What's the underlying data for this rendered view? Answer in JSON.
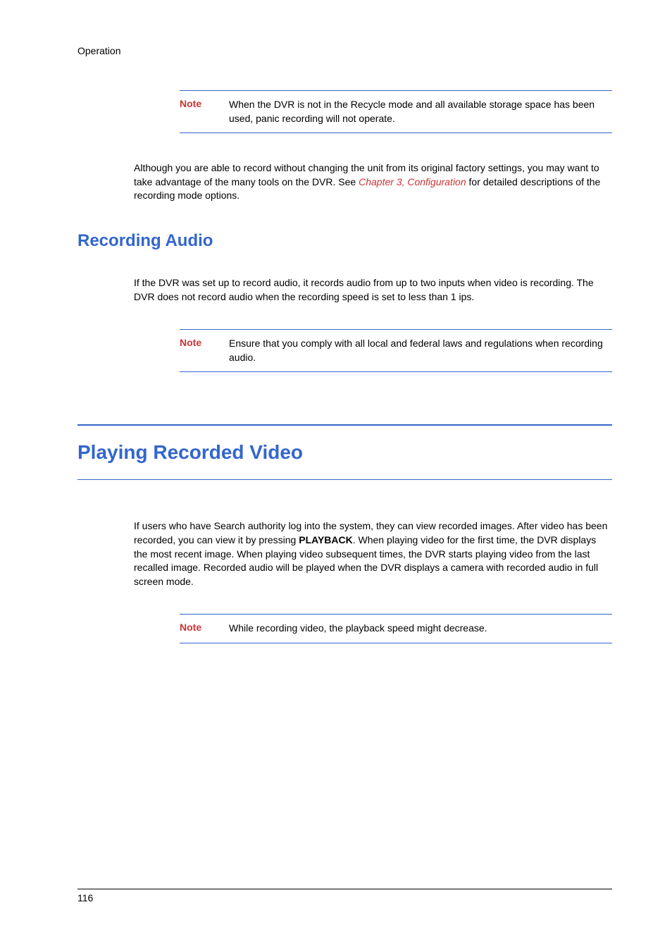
{
  "header": {
    "section_label": "Operation"
  },
  "note1": {
    "label": "Note",
    "text": "When the DVR is not in the Recycle mode and all available storage space has been used, panic recording will not operate."
  },
  "para1": {
    "pre_link": "Although you are able to record without changing the unit from its original factory settings, you may want to take advantage of the many tools on the DVR. See ",
    "link": "Chapter 3, Configuration",
    "post_link": " for detailed descriptions of the recording mode options."
  },
  "section_heading1": "Recording Audio",
  "para2": "If the DVR was set up to record audio, it records audio from up to two inputs when video is recording. The DVR does not record audio when the recording speed is set to less than 1 ips.",
  "note2": {
    "label": "Note",
    "text": "Ensure that you comply with all local and federal laws and regulations when recording audio."
  },
  "main_heading": "Playing Recorded Video",
  "para3": {
    "pre": "If users who have Search authority log into the system, they can view recorded images. After video has been recorded, you can view it by pressing ",
    "bold": "PLAYBACK",
    "post": ". When playing video for the first time, the DVR displays the most recent image. When playing video subsequent times, the DVR starts playing video from the last recalled image. Recorded audio will be played when the DVR displays a camera with recorded audio in full screen mode."
  },
  "note3": {
    "label": "Note",
    "text": "While recording video, the playback speed might decrease."
  },
  "footer": {
    "page_number": "116"
  }
}
